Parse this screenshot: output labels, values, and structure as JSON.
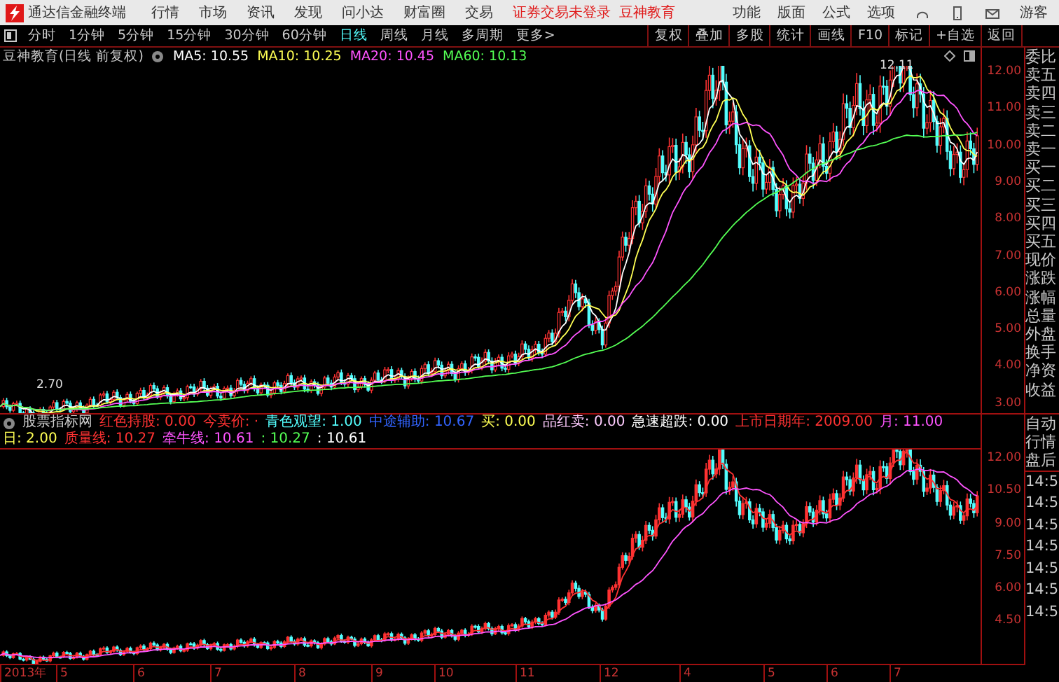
{
  "menubar": {
    "app_title": "通达信金融终端",
    "menus": [
      "行情",
      "市场",
      "资讯",
      "发现",
      "问小达",
      "财富圈",
      "交易"
    ],
    "notices": [
      "证券交易未登录",
      "豆神教育"
    ],
    "right_menus": [
      "功能",
      "版面",
      "公式",
      "选项"
    ],
    "user": "游客"
  },
  "toolbar": {
    "periods": [
      {
        "label": "分时",
        "selected": false
      },
      {
        "label": "1分钟",
        "selected": false
      },
      {
        "label": "5分钟",
        "selected": false
      },
      {
        "label": "15分钟",
        "selected": false
      },
      {
        "label": "30分钟",
        "selected": false
      },
      {
        "label": "60分钟",
        "selected": false
      },
      {
        "label": "日线",
        "selected": true
      },
      {
        "label": "周线",
        "selected": false
      },
      {
        "label": "月线",
        "selected": false
      },
      {
        "label": "多周期",
        "selected": false
      },
      {
        "label": "更多>",
        "selected": false
      }
    ],
    "tools": [
      "复权",
      "叠加",
      "多股",
      "统计",
      "画线",
      "F10",
      "标记",
      "+自选",
      "返回"
    ]
  },
  "price_chart": {
    "title": "豆神教育(日线 前复权)",
    "indicators": [
      {
        "label": "MA5: 10.55",
        "color": "#ffffff"
      },
      {
        "label": "MA10: 10.25",
        "color": "#ffff54"
      },
      {
        "label": "MA20: 10.45",
        "color": "#ff54ff"
      },
      {
        "label": "MA60: 10.13",
        "color": "#54ff54"
      }
    ],
    "high_label": "12.11",
    "low_label": "2.70",
    "y_ticks": [
      "12.00",
      "11.00",
      "10.00",
      "9.00",
      "8.00",
      "7.00",
      "6.00",
      "5.00",
      "4.00",
      "3.00"
    ]
  },
  "indicator_chart": {
    "title": "股票指标网",
    "values": [
      {
        "label": "红色持股: 0.00",
        "color": "#ff3232"
      },
      {
        "label": "今卖价: ·",
        "color": "#ff3232"
      },
      {
        "label": "青色观望: 1.00",
        "color": "#54ffff"
      },
      {
        "label": "中途辅助: 10.67",
        "color": "#3264ff"
      },
      {
        "label": "买: 0.00",
        "color": "#ffff54"
      },
      {
        "label": "品红卖: 0.00",
        "color": "#ffccff"
      },
      {
        "label": "急速超跌: 0.00",
        "color": "#ffffff"
      },
      {
        "label": "上市日期年: 2009.00",
        "color": "#ff3232"
      },
      {
        "label": "月: 11.00",
        "color": "#ff54ff"
      },
      {
        "label": "日: 2.00",
        "color": "#ffff54"
      },
      {
        "label": "质量线: 10.27",
        "color": "#ff3232"
      },
      {
        "label": "牵牛线: 10.61",
        "color": "#ff54ff"
      },
      {
        "label": ": 10.27",
        "color": "#54ff54"
      },
      {
        "label": ": 10.61",
        "color": "#ffffff"
      }
    ],
    "y_ticks": [
      "12.00",
      "10.50",
      "9.00",
      "7.50",
      "6.00",
      "4.50"
    ]
  },
  "x_axis": {
    "labels": [
      "2013年",
      "5",
      "6",
      "7",
      "8",
      "9",
      "10",
      "11",
      "12",
      "4",
      "5",
      "6",
      "7"
    ]
  },
  "quote_panel": {
    "fields": [
      "委比",
      "卖五",
      "卖四",
      "卖三",
      "卖二",
      "卖一",
      "买一",
      "买二",
      "买三",
      "买四",
      "买五",
      "现价",
      "涨跌",
      "涨幅",
      "总量",
      "外盘",
      "换手",
      "净资",
      "收益"
    ],
    "modes": [
      "自动",
      "行情",
      "盘后"
    ],
    "times": [
      "14:5",
      "14:5",
      "14:5",
      "14:5",
      "14:5",
      "14:5",
      "14:5"
    ]
  }
}
